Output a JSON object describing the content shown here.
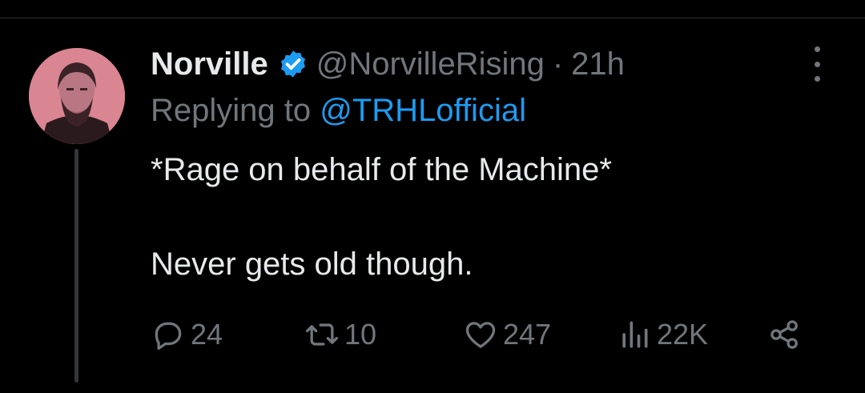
{
  "post": {
    "author": {
      "display_name": "Norville",
      "handle": "@NorvilleRising",
      "verified": true
    },
    "time_separator": "·",
    "time": "21h",
    "reply_prefix": "Replying to",
    "reply_to": "@TRHLofficial",
    "text_lines": [
      "*Rage on behalf of the Machine*",
      "Never gets old though."
    ],
    "metrics": {
      "replies": "24",
      "reposts": "10",
      "likes": "247",
      "views": "22K"
    }
  },
  "icons": {
    "verified": "verified-badge-icon",
    "more": "more-options-icon",
    "reply": "reply-icon",
    "repost": "repost-icon",
    "like": "like-icon",
    "views": "views-icon",
    "share": "share-icon"
  },
  "colors": {
    "background": "#000000",
    "text": "#e7e9ea",
    "muted": "#71767b",
    "accent": "#1d9bf0"
  }
}
